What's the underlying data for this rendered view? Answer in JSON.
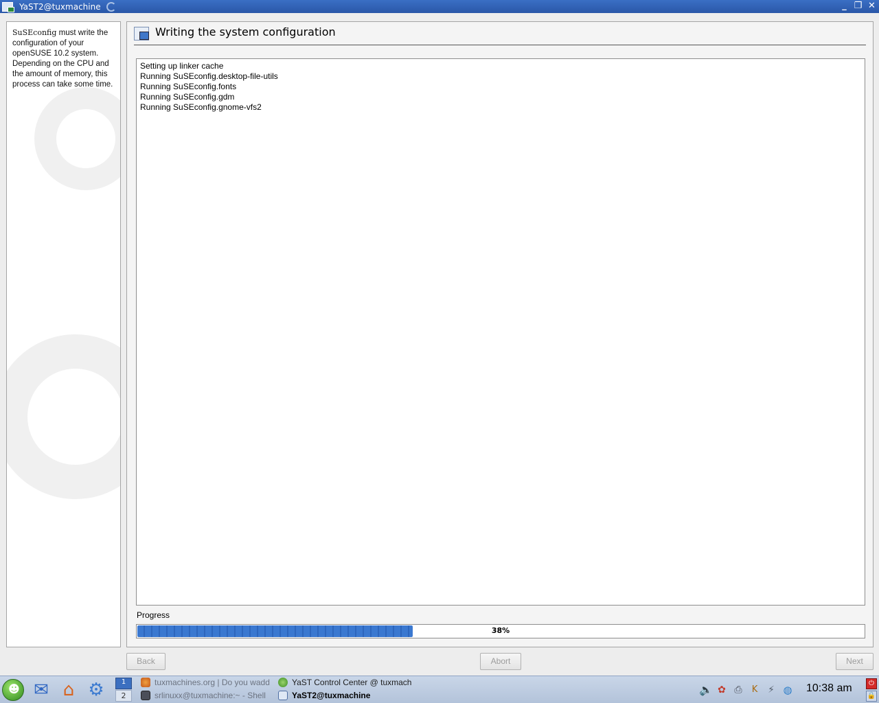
{
  "window": {
    "title": "YaST2@tuxmachine",
    "controls": [
      "minimize-icon",
      "maximize-icon",
      "close-icon"
    ]
  },
  "help": {
    "code_word": "SuSEconfig",
    "text": " must write the configuration of your openSUSE 10.2 system. Depending on the CPU and the amount of memory, this process can take some time."
  },
  "main": {
    "title": "Writing the system configuration",
    "log_lines": [
      "Setting up linker cache",
      "Running SuSEconfig.desktop-file-utils",
      "Running SuSEconfig.fonts",
      "Running SuSEconfig.gdm",
      "Running SuSEconfig.gnome-vfs2"
    ],
    "progress_label": "Progress",
    "progress_value": 38,
    "progress_text": "38%"
  },
  "buttons": {
    "back": "Back",
    "abort": "Abort",
    "next": "Next"
  },
  "taskbar": {
    "pager": [
      "1",
      "2"
    ],
    "tasks": [
      {
        "label": "tuxmachines.org | Do you wadd",
        "icon": "firefox-icon",
        "active": false
      },
      {
        "label": "srlinuxx@tuxmachine:~ - Shell",
        "icon": "terminal-icon",
        "active": false
      },
      {
        "label": "YaST Control Center @ tuxmach",
        "icon": "yast-icon",
        "active": false
      },
      {
        "label": "YaST2@tuxmachine",
        "icon": "yast2-icon",
        "active": true
      }
    ],
    "clock": "10:38 am"
  }
}
